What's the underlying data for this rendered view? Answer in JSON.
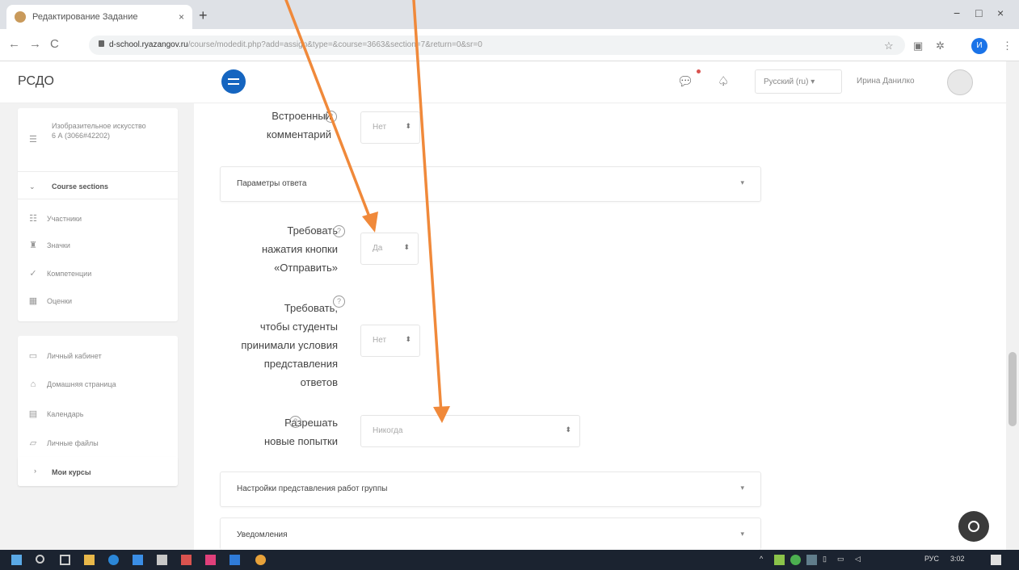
{
  "browser": {
    "tab_title": "Редактирование Задание",
    "tab_close": "×",
    "new_tab": "+",
    "url_domain": "d-school.ryazangov.ru",
    "url_path": "/course/modedit.php?add=assign&type=&course=3663&section=7&return=0&sr=0",
    "profile_initial": "И",
    "back": "←",
    "forward": "→",
    "reload": "C",
    "minimize": "−",
    "maximize": "□",
    "close": "×"
  },
  "navbar": {
    "brand": "РСДО",
    "language": "Русский (ru) ▾",
    "user_name": "Ирина Данилко"
  },
  "drawer": {
    "course_title": "Изобразительное искусство 6 А (3066#42202)",
    "course_sections": "Course sections",
    "items": [
      {
        "label": "Участники",
        "icon": "users-icon"
      },
      {
        "label": "Значки",
        "icon": "trophy-icon"
      },
      {
        "label": "Компетенции",
        "icon": "check-icon"
      },
      {
        "label": "Оценки",
        "icon": "grid-icon"
      }
    ],
    "items2": [
      {
        "label": "Личный кабинет",
        "icon": "dashboard-icon"
      },
      {
        "label": "Домашняя страница",
        "icon": "home-icon"
      },
      {
        "label": "Календарь",
        "icon": "calendar-icon"
      },
      {
        "label": "Личные файлы",
        "icon": "files-icon"
      }
    ],
    "my_courses": "Мои курсы"
  },
  "form": {
    "inline_comments": {
      "label_line1": "Встроенный",
      "label_line2": "комментарий",
      "value": "Нет"
    },
    "section_answer_params": "Параметры ответа",
    "require_submit": {
      "label_line1": "Требовать",
      "label_line2": "нажатия кнопки",
      "label_line3": "«Отправить»",
      "value": "Да"
    },
    "require_accept": {
      "label_line1": "Требовать,",
      "label_line2": "чтобы студенты",
      "label_line3": "принимали условия",
      "label_line4": "представления",
      "label_line5": "ответов",
      "value": "Нет"
    },
    "allow_reopen": {
      "label_line1": "Разрешать",
      "label_line2": "новые попытки",
      "value": "Никогда"
    },
    "section_group": "Настройки представления работ группы",
    "section_notifications": "Уведомления"
  },
  "taskbar": {
    "lang": "РУС",
    "time": "3:02"
  },
  "colors": {
    "arrow": "#f0893a",
    "brand_button": "#1565c0",
    "taskbar": "#1b2330"
  }
}
